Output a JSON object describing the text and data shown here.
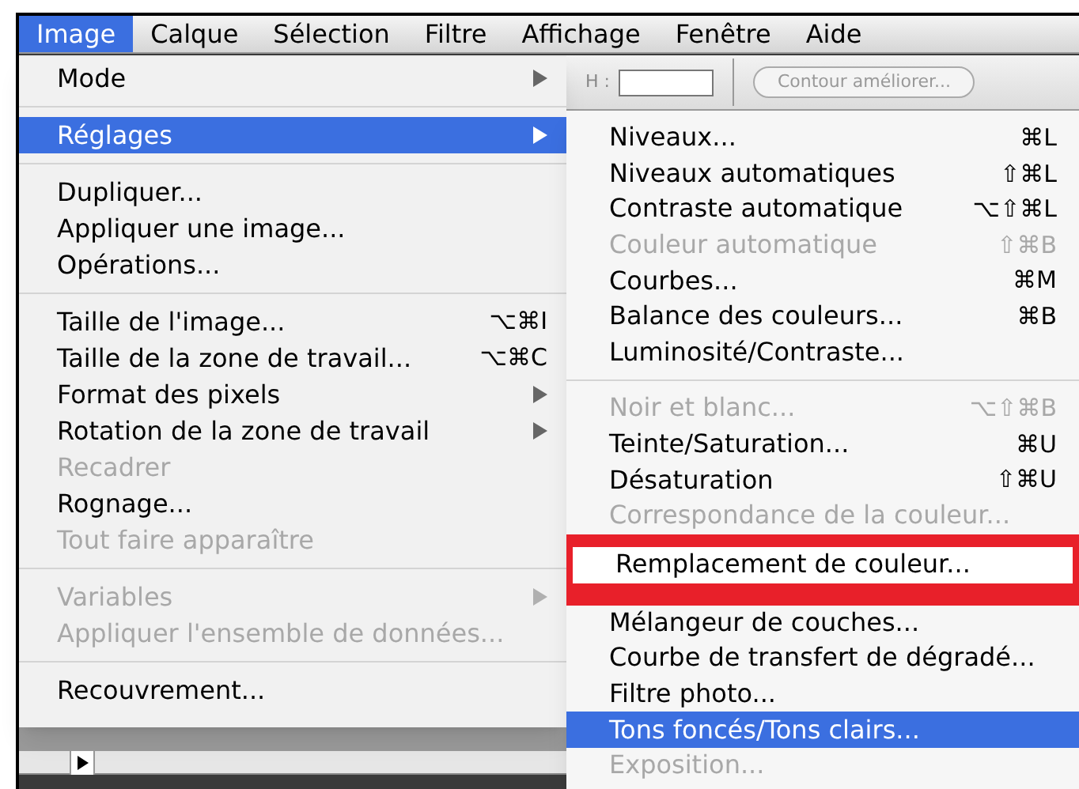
{
  "menu_bar": [
    {
      "label": "Image",
      "selected": true
    },
    {
      "label": "Calque",
      "selected": false
    },
    {
      "label": "Sélection",
      "selected": false
    },
    {
      "label": "Filtre",
      "selected": false
    },
    {
      "label": "Affichage",
      "selected": false
    },
    {
      "label": "Fenêtre",
      "selected": false
    },
    {
      "label": "Aide",
      "selected": false
    }
  ],
  "options_bar": {
    "field_label": "H :",
    "button": "Contour améliorer...",
    "disabled": true
  },
  "image_menu": [
    {
      "kind": "item",
      "label": "Mode",
      "submenu": true,
      "disabled": false,
      "selected": false
    },
    {
      "kind": "separator"
    },
    {
      "kind": "item",
      "label": "Réglages",
      "submenu": true,
      "disabled": false,
      "selected": true
    },
    {
      "kind": "separator"
    },
    {
      "kind": "item",
      "label": "Dupliquer...",
      "disabled": false,
      "selected": false
    },
    {
      "kind": "item",
      "label": "Appliquer une image...",
      "disabled": false,
      "selected": false
    },
    {
      "kind": "item",
      "label": "Opérations...",
      "disabled": false,
      "selected": false
    },
    {
      "kind": "separator"
    },
    {
      "kind": "item",
      "label": "Taille de l'image...",
      "shortcut": "⌥⌘I",
      "disabled": false,
      "selected": false
    },
    {
      "kind": "item",
      "label": "Taille de la zone de travail...",
      "shortcut": "⌥⌘C",
      "disabled": false,
      "selected": false
    },
    {
      "kind": "item",
      "label": "Format des pixels",
      "submenu": true,
      "disabled": false,
      "selected": false
    },
    {
      "kind": "item",
      "label": "Rotation de la zone de travail",
      "submenu": true,
      "disabled": false,
      "selected": false
    },
    {
      "kind": "item",
      "label": "Recadrer",
      "disabled": true,
      "selected": false
    },
    {
      "kind": "item",
      "label": "Rognage...",
      "disabled": false,
      "selected": false
    },
    {
      "kind": "item",
      "label": "Tout faire apparaître",
      "disabled": true,
      "selected": false
    },
    {
      "kind": "separator"
    },
    {
      "kind": "item",
      "label": "Variables",
      "submenu": true,
      "disabled": true,
      "selected": false
    },
    {
      "kind": "item",
      "label": "Appliquer l'ensemble de données...",
      "disabled": true,
      "selected": false
    },
    {
      "kind": "separator"
    },
    {
      "kind": "item",
      "label": "Recouvrement...",
      "disabled": false,
      "selected": false
    }
  ],
  "adjustments_menu": [
    {
      "kind": "item",
      "label": "Niveaux...",
      "shortcut": "⌘L",
      "disabled": false,
      "selected": false
    },
    {
      "kind": "item",
      "label": "Niveaux automatiques",
      "shortcut": "⇧⌘L",
      "disabled": false,
      "selected": false
    },
    {
      "kind": "item",
      "label": "Contraste automatique",
      "shortcut": "⌥⇧⌘L",
      "disabled": false,
      "selected": false
    },
    {
      "kind": "item",
      "label": "Couleur automatique",
      "shortcut": "⇧⌘B",
      "disabled": true,
      "selected": false
    },
    {
      "kind": "item",
      "label": "Courbes...",
      "shortcut": "⌘M",
      "disabled": false,
      "selected": false
    },
    {
      "kind": "item",
      "label": "Balance des couleurs...",
      "shortcut": "⌘B",
      "disabled": false,
      "selected": false
    },
    {
      "kind": "item",
      "label": "Luminosité/Contraste...",
      "disabled": false,
      "selected": false
    },
    {
      "kind": "separator"
    },
    {
      "kind": "item",
      "label": "Noir et blanc...",
      "shortcut": "⌥⇧⌘B",
      "disabled": true,
      "selected": false
    },
    {
      "kind": "item",
      "label": "Teinte/Saturation...",
      "shortcut": "⌘U",
      "disabled": false,
      "selected": false
    },
    {
      "kind": "item",
      "label": "Désaturation",
      "shortcut": "⇧⌘U",
      "disabled": false,
      "selected": false
    },
    {
      "kind": "item",
      "label": "Correspondance de la couleur...",
      "disabled": true,
      "selected": false
    },
    {
      "kind": "item",
      "label": "Remplacement de couleur...",
      "disabled": false,
      "selected": false,
      "outlined": true
    },
    {
      "kind": "item",
      "label": "Mélangeur de couches...",
      "disabled": false,
      "selected": false
    },
    {
      "kind": "item",
      "label": "Courbe de transfert de dégradé...",
      "disabled": false,
      "selected": false
    },
    {
      "kind": "item",
      "label": "Filtre photo...",
      "disabled": false,
      "selected": false
    },
    {
      "kind": "item",
      "label": "Tons foncés/Tons clairs...",
      "disabled": false,
      "selected": true
    },
    {
      "kind": "item",
      "label": "Exposition...",
      "disabled": true,
      "selected": false
    }
  ]
}
